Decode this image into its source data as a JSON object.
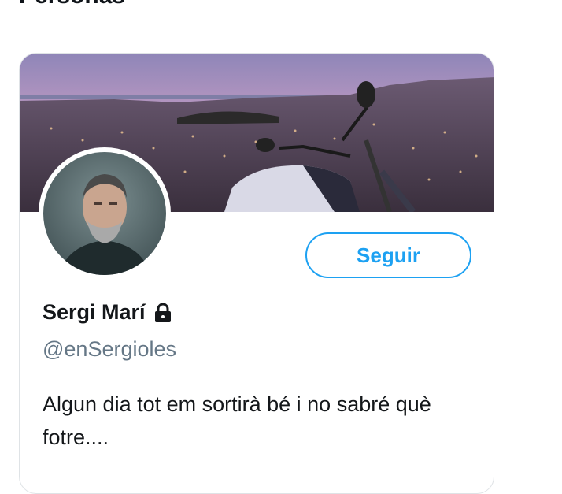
{
  "section": {
    "title": "Personas"
  },
  "profile_card": {
    "display_name": "Sergi Marí",
    "handle": "@enSergioles",
    "bio": "Algun dia tot em sortirà bé i no sabré què fotre....",
    "follow_label": "Seguir",
    "locked": true,
    "banner_icon": "city-night-motorcycle-photo",
    "avatar_icon": "profile-photo",
    "lock_icon": "lock-icon"
  },
  "colors": {
    "accent": "#1da1f2",
    "text_primary": "#14171a",
    "text_secondary": "#657786",
    "border": "#dfe3e6"
  }
}
